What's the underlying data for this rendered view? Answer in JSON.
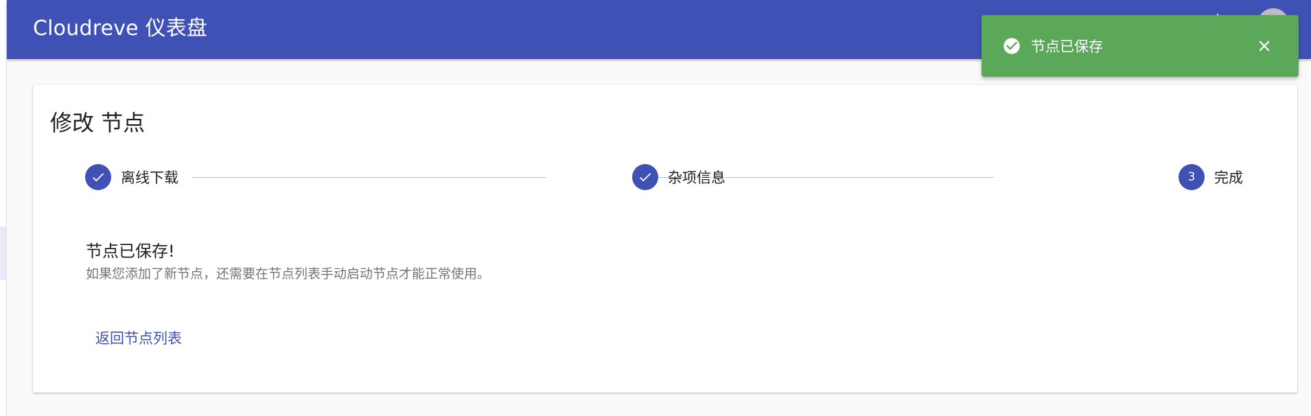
{
  "appbar": {
    "title": "Cloudreve 仪表盘",
    "icon": "translate-icon",
    "avatar": "user-avatar"
  },
  "card": {
    "title": "修改 节点",
    "steps": [
      {
        "label": "离线下载",
        "state": "completed",
        "icon": "check-icon"
      },
      {
        "label": "杂项信息",
        "state": "completed",
        "icon": "check-icon"
      },
      {
        "label": "完成",
        "state": "active",
        "number": "3"
      }
    ],
    "success_heading": "节点已保存!",
    "success_description": "如果您添加了新节点，还需要在节点列表手动启动节点才能正常使用。",
    "back_button_label": "返回节点列表"
  },
  "snackbar": {
    "message": "节点已保存",
    "icon": "check-circle-icon",
    "close_icon": "close-icon"
  },
  "colors": {
    "primary": "#3f51b5",
    "success": "#5ca85a",
    "text_primary": "#212121",
    "text_secondary": "#757575"
  }
}
